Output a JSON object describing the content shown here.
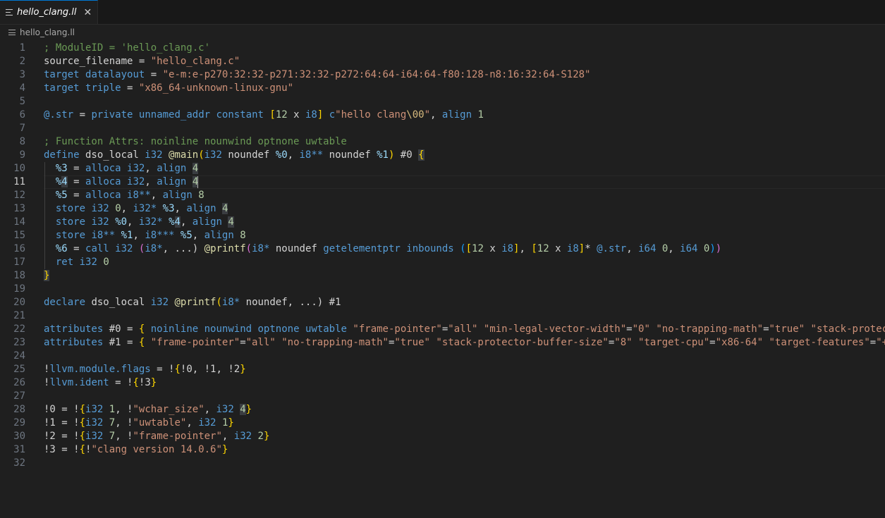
{
  "tab": {
    "label": "hello_clang.ll",
    "icon": "list-icon",
    "close_icon": "close-icon"
  },
  "breadcrumb": {
    "label": "hello_clang.ll",
    "icon": "list-icon"
  },
  "editor": {
    "active_line": 11
  },
  "colors": {
    "comment": "#6a9955",
    "plain": "#d4d4d4",
    "string": "#ce9178",
    "keyword": "#569cd6",
    "type": "#4ec9b0",
    "number": "#b5cea8",
    "variable": "#9cdcfe",
    "function": "#dcdcaa",
    "bracket": "#ffd700",
    "bracket2": "#da70d6",
    "bracket3": "#179fff",
    "escape": "#d7ba7d"
  },
  "lines": [
    [
      [
        "c",
        "; ModuleID = 'hello_clang.c'"
      ]
    ],
    [
      [
        "p",
        "source_filename = "
      ],
      [
        "s",
        "\"hello_clang.c\""
      ]
    ],
    [
      [
        "k",
        "target"
      ],
      [
        "p",
        " "
      ],
      [
        "k",
        "datalayout"
      ],
      [
        "p",
        " = "
      ],
      [
        "s",
        "\"e-m:e-p270:32:32-p271:32:32-p272:64:64-i64:64-f80:128-n8:16:32:64-S128\""
      ]
    ],
    [
      [
        "k",
        "target"
      ],
      [
        "p",
        " "
      ],
      [
        "k",
        "triple"
      ],
      [
        "p",
        " = "
      ],
      [
        "s",
        "\"x86_64-unknown-linux-gnu\""
      ]
    ],
    [],
    [
      [
        "k",
        "@.str"
      ],
      [
        "p",
        " = "
      ],
      [
        "k",
        "private"
      ],
      [
        "p",
        " "
      ],
      [
        "k",
        "unnamed_addr"
      ],
      [
        "p",
        " "
      ],
      [
        "k",
        "constant"
      ],
      [
        "p",
        " "
      ],
      [
        "b",
        "["
      ],
      [
        "n",
        "12"
      ],
      [
        "p",
        " x "
      ],
      [
        "k",
        "i8"
      ],
      [
        "b",
        "]"
      ],
      [
        "p",
        " "
      ],
      [
        "k",
        "c"
      ],
      [
        "s",
        "\"hello clang"
      ],
      [
        "e",
        "\\00"
      ],
      [
        "s",
        "\""
      ],
      [
        "p",
        ", "
      ],
      [
        "k",
        "align"
      ],
      [
        "p",
        " "
      ],
      [
        "n",
        "1"
      ]
    ],
    [],
    [
      [
        "c",
        "; Function Attrs: noinline nounwind optnone uwtable"
      ]
    ],
    [
      [
        "k",
        "define"
      ],
      [
        "p",
        " dso_local "
      ],
      [
        "k",
        "i32"
      ],
      [
        "p",
        " "
      ],
      [
        "f",
        "@main"
      ],
      [
        "b",
        "("
      ],
      [
        "k",
        "i32"
      ],
      [
        "p",
        " noundef "
      ],
      [
        "v",
        "%0"
      ],
      [
        "p",
        ", "
      ],
      [
        "k",
        "i8**"
      ],
      [
        "p",
        " noundef "
      ],
      [
        "v",
        "%1"
      ],
      [
        "b",
        ")"
      ],
      [
        "p",
        " #0 "
      ],
      [
        "bh",
        "{"
      ]
    ],
    [
      [
        "p",
        "  "
      ],
      [
        "v",
        "%3"
      ],
      [
        "p",
        " = "
      ],
      [
        "k",
        "alloca"
      ],
      [
        "p",
        " "
      ],
      [
        "k",
        "i32"
      ],
      [
        "p",
        ", "
      ],
      [
        "k",
        "align"
      ],
      [
        "p",
        " "
      ],
      [
        "nh",
        "4"
      ]
    ],
    [
      [
        "p",
        "  "
      ],
      [
        "v",
        "%"
      ],
      [
        "vh",
        "4"
      ],
      [
        "p",
        " = "
      ],
      [
        "k",
        "alloca"
      ],
      [
        "p",
        " "
      ],
      [
        "k",
        "i32"
      ],
      [
        "p",
        ", "
      ],
      [
        "k",
        "align"
      ],
      [
        "p",
        " "
      ],
      [
        "nh",
        "4"
      ],
      [
        "cur",
        ""
      ]
    ],
    [
      [
        "p",
        "  "
      ],
      [
        "v",
        "%5"
      ],
      [
        "p",
        " = "
      ],
      [
        "k",
        "alloca"
      ],
      [
        "p",
        " "
      ],
      [
        "k",
        "i8**"
      ],
      [
        "p",
        ", "
      ],
      [
        "k",
        "align"
      ],
      [
        "p",
        " "
      ],
      [
        "n",
        "8"
      ]
    ],
    [
      [
        "p",
        "  "
      ],
      [
        "k",
        "store"
      ],
      [
        "p",
        " "
      ],
      [
        "k",
        "i32"
      ],
      [
        "p",
        " "
      ],
      [
        "n",
        "0"
      ],
      [
        "p",
        ", "
      ],
      [
        "k",
        "i32*"
      ],
      [
        "p",
        " "
      ],
      [
        "v",
        "%3"
      ],
      [
        "p",
        ", "
      ],
      [
        "k",
        "align"
      ],
      [
        "p",
        " "
      ],
      [
        "nh",
        "4"
      ]
    ],
    [
      [
        "p",
        "  "
      ],
      [
        "k",
        "store"
      ],
      [
        "p",
        " "
      ],
      [
        "k",
        "i32"
      ],
      [
        "p",
        " "
      ],
      [
        "v",
        "%0"
      ],
      [
        "p",
        ", "
      ],
      [
        "k",
        "i32*"
      ],
      [
        "p",
        " "
      ],
      [
        "v",
        "%"
      ],
      [
        "vh",
        "4"
      ],
      [
        "p",
        ", "
      ],
      [
        "k",
        "align"
      ],
      [
        "p",
        " "
      ],
      [
        "nh",
        "4"
      ]
    ],
    [
      [
        "p",
        "  "
      ],
      [
        "k",
        "store"
      ],
      [
        "p",
        " "
      ],
      [
        "k",
        "i8**"
      ],
      [
        "p",
        " "
      ],
      [
        "v",
        "%1"
      ],
      [
        "p",
        ", "
      ],
      [
        "k",
        "i8***"
      ],
      [
        "p",
        " "
      ],
      [
        "v",
        "%5"
      ],
      [
        "p",
        ", "
      ],
      [
        "k",
        "align"
      ],
      [
        "p",
        " "
      ],
      [
        "n",
        "8"
      ]
    ],
    [
      [
        "p",
        "  "
      ],
      [
        "v",
        "%6"
      ],
      [
        "p",
        " = "
      ],
      [
        "k",
        "call"
      ],
      [
        "p",
        " "
      ],
      [
        "k",
        "i32"
      ],
      [
        "p",
        " "
      ],
      [
        "b2",
        "("
      ],
      [
        "k",
        "i8*"
      ],
      [
        "p",
        ", ...) "
      ],
      [
        "f",
        "@printf"
      ],
      [
        "b2",
        "("
      ],
      [
        "k",
        "i8*"
      ],
      [
        "p",
        " noundef "
      ],
      [
        "k",
        "getelementptr"
      ],
      [
        "p",
        " "
      ],
      [
        "k",
        "inbounds"
      ],
      [
        "p",
        " "
      ],
      [
        "b3",
        "("
      ],
      [
        "b",
        "["
      ],
      [
        "n",
        "12"
      ],
      [
        "p",
        " x "
      ],
      [
        "k",
        "i8"
      ],
      [
        "b",
        "]"
      ],
      [
        "p",
        ", "
      ],
      [
        "b",
        "["
      ],
      [
        "n",
        "12"
      ],
      [
        "p",
        " x "
      ],
      [
        "k",
        "i8"
      ],
      [
        "b",
        "]"
      ],
      [
        "p",
        "* "
      ],
      [
        "k",
        "@.str"
      ],
      [
        "p",
        ", "
      ],
      [
        "k",
        "i64"
      ],
      [
        "p",
        " "
      ],
      [
        "n",
        "0"
      ],
      [
        "p",
        ", "
      ],
      [
        "k",
        "i64"
      ],
      [
        "p",
        " "
      ],
      [
        "n",
        "0"
      ],
      [
        "b3",
        ")"
      ],
      [
        "b2",
        ")"
      ]
    ],
    [
      [
        "p",
        "  "
      ],
      [
        "k",
        "ret"
      ],
      [
        "p",
        " "
      ],
      [
        "k",
        "i32"
      ],
      [
        "p",
        " "
      ],
      [
        "n",
        "0"
      ]
    ],
    [
      [
        "bh",
        "}"
      ]
    ],
    [],
    [
      [
        "k",
        "declare"
      ],
      [
        "p",
        " dso_local "
      ],
      [
        "k",
        "i32"
      ],
      [
        "p",
        " "
      ],
      [
        "f",
        "@printf"
      ],
      [
        "b",
        "("
      ],
      [
        "k",
        "i8*"
      ],
      [
        "p",
        " noundef, ...) "
      ],
      [
        "p",
        "#1"
      ]
    ],
    [],
    [
      [
        "k",
        "attributes"
      ],
      [
        "p",
        " #0 = "
      ],
      [
        "b",
        "{"
      ],
      [
        "p",
        " "
      ],
      [
        "k",
        "noinline"
      ],
      [
        "p",
        " "
      ],
      [
        "k",
        "nounwind"
      ],
      [
        "p",
        " "
      ],
      [
        "k",
        "optnone"
      ],
      [
        "p",
        " "
      ],
      [
        "k",
        "uwtable"
      ],
      [
        "p",
        " "
      ],
      [
        "s",
        "\"frame-pointer\""
      ],
      [
        "p",
        "="
      ],
      [
        "s",
        "\"all\""
      ],
      [
        "p",
        " "
      ],
      [
        "s",
        "\"min-legal-vector-width\""
      ],
      [
        "p",
        "="
      ],
      [
        "s",
        "\"0\""
      ],
      [
        "p",
        " "
      ],
      [
        "s",
        "\"no-trapping-math\""
      ],
      [
        "p",
        "="
      ],
      [
        "s",
        "\"true\""
      ],
      [
        "p",
        " "
      ],
      [
        "s",
        "\"stack-protec"
      ]
    ],
    [
      [
        "k",
        "attributes"
      ],
      [
        "p",
        " #1 = "
      ],
      [
        "b",
        "{"
      ],
      [
        "p",
        " "
      ],
      [
        "s",
        "\"frame-pointer\""
      ],
      [
        "p",
        "="
      ],
      [
        "s",
        "\"all\""
      ],
      [
        "p",
        " "
      ],
      [
        "s",
        "\"no-trapping-math\""
      ],
      [
        "p",
        "="
      ],
      [
        "s",
        "\"true\""
      ],
      [
        "p",
        " "
      ],
      [
        "s",
        "\"stack-protector-buffer-size\""
      ],
      [
        "p",
        "="
      ],
      [
        "s",
        "\"8\""
      ],
      [
        "p",
        " "
      ],
      [
        "s",
        "\"target-cpu\""
      ],
      [
        "p",
        "="
      ],
      [
        "s",
        "\"x86-64\""
      ],
      [
        "p",
        " "
      ],
      [
        "s",
        "\"target-features\""
      ],
      [
        "p",
        "="
      ],
      [
        "s",
        "\"+"
      ]
    ],
    [],
    [
      [
        "p",
        "!"
      ],
      [
        "k",
        "llvm.module.flags"
      ],
      [
        "p",
        " = !"
      ],
      [
        "b",
        "{"
      ],
      [
        "p",
        "!0, !1, !2"
      ],
      [
        "b",
        "}"
      ]
    ],
    [
      [
        "p",
        "!"
      ],
      [
        "k",
        "llvm.ident"
      ],
      [
        "p",
        " = !"
      ],
      [
        "b",
        "{"
      ],
      [
        "p",
        "!3"
      ],
      [
        "b",
        "}"
      ]
    ],
    [],
    [
      [
        "p",
        "!0 = !"
      ],
      [
        "b",
        "{"
      ],
      [
        "k",
        "i32"
      ],
      [
        "p",
        " "
      ],
      [
        "n",
        "1"
      ],
      [
        "p",
        ", !"
      ],
      [
        "s",
        "\"wchar_size\""
      ],
      [
        "p",
        ", "
      ],
      [
        "k",
        "i32"
      ],
      [
        "p",
        " "
      ],
      [
        "nh",
        "4"
      ],
      [
        "b",
        "}"
      ]
    ],
    [
      [
        "p",
        "!1 = !"
      ],
      [
        "b",
        "{"
      ],
      [
        "k",
        "i32"
      ],
      [
        "p",
        " "
      ],
      [
        "n",
        "7"
      ],
      [
        "p",
        ", !"
      ],
      [
        "s",
        "\"uwtable\""
      ],
      [
        "p",
        ", "
      ],
      [
        "k",
        "i32"
      ],
      [
        "p",
        " "
      ],
      [
        "n",
        "1"
      ],
      [
        "b",
        "}"
      ]
    ],
    [
      [
        "p",
        "!2 = !"
      ],
      [
        "b",
        "{"
      ],
      [
        "k",
        "i32"
      ],
      [
        "p",
        " "
      ],
      [
        "n",
        "7"
      ],
      [
        "p",
        ", !"
      ],
      [
        "s",
        "\"frame-pointer\""
      ],
      [
        "p",
        ", "
      ],
      [
        "k",
        "i32"
      ],
      [
        "p",
        " "
      ],
      [
        "n",
        "2"
      ],
      [
        "b",
        "}"
      ]
    ],
    [
      [
        "p",
        "!3 = !"
      ],
      [
        "b",
        "{"
      ],
      [
        "p",
        "!"
      ],
      [
        "s",
        "\"clang version 14.0.6\""
      ],
      [
        "b",
        "}"
      ]
    ],
    []
  ]
}
